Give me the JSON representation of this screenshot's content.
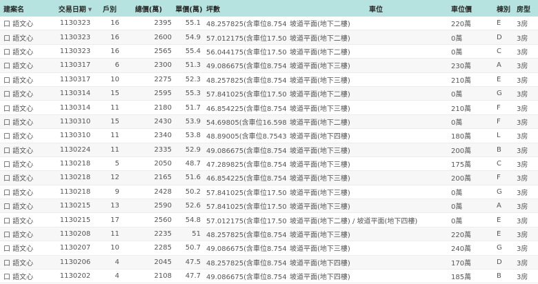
{
  "columns": {
    "name": "建案名",
    "date": "交易日期",
    "households": "戶別",
    "total": "總價(萬)",
    "unit": "單價(萬)",
    "area": "坪數",
    "parking": "車位",
    "parking_price": "車位價",
    "type": "棟別",
    "rooms": "房型"
  },
  "rows": [
    {
      "name": "口 語文心",
      "date": "1130323",
      "households": "16",
      "total": "2395",
      "unit": "55.1",
      "area": "48.257825(含車位8.75435)",
      "parking": "坡道平面(地下二樓)",
      "parking_price": "220萬",
      "type": "E",
      "rooms": "3房"
    },
    {
      "name": "口 語文心",
      "date": "1130323",
      "households": "16",
      "total": "2600",
      "unit": "54.9",
      "area": "57.012175(含車位17.5087)",
      "parking": "坡道平面(地下二樓)",
      "parking_price": "0萬",
      "type": "D",
      "rooms": "3房"
    },
    {
      "name": "口 語文心",
      "date": "1130323",
      "households": "16",
      "total": "2565",
      "unit": "55.4",
      "area": "56.044175(含車位17.5087)",
      "parking": "坡道平面(地下二樓)",
      "parking_price": "0萬",
      "type": "C",
      "rooms": "3房"
    },
    {
      "name": "口 語文心",
      "date": "1130317",
      "households": "6",
      "total": "2300",
      "unit": "51.3",
      "area": "49.086675(含車位8.75435)",
      "parking": "坡道平面(地下三樓)",
      "parking_price": "230萬",
      "type": "A",
      "rooms": "3房"
    },
    {
      "name": "口 語文心",
      "date": "1130317",
      "households": "10",
      "total": "2275",
      "unit": "52.3",
      "area": "48.257825(含車位8.75435)",
      "parking": "坡道平面(地下三樓)",
      "parking_price": "210萬",
      "type": "E",
      "rooms": "3房"
    },
    {
      "name": "口 語文心",
      "date": "1130314",
      "households": "15",
      "total": "2595",
      "unit": "55.3",
      "area": "57.841025(含車位17.5087)",
      "parking": "坡道平面(地下二樓)",
      "parking_price": "0萬",
      "type": "G",
      "rooms": "3房"
    },
    {
      "name": "口 語文心",
      "date": "1130314",
      "households": "11",
      "total": "2180",
      "unit": "51.7",
      "area": "46.854225(含車位8.75435)",
      "parking": "坡道平面(地下三樓)",
      "parking_price": "210萬",
      "type": "F",
      "rooms": "3房"
    },
    {
      "name": "口 語文心",
      "date": "1130310",
      "households": "15",
      "total": "2430",
      "unit": "53.9",
      "area": "54.69805(含車位16.598175)",
      "parking": "坡道平面(地下二樓)",
      "parking_price": "0萬",
      "type": "F",
      "rooms": "3房"
    },
    {
      "name": "口 語文心",
      "date": "1130310",
      "households": "11",
      "total": "2340",
      "unit": "53.8",
      "area": "48.89005(含車位8.75435)",
      "parking": "坡道平面(地下四樓)",
      "parking_price": "180萬",
      "type": "L",
      "rooms": "3房"
    },
    {
      "name": "口 語文心",
      "date": "1130224",
      "households": "11",
      "total": "2335",
      "unit": "52.9",
      "area": "49.086675(含車位8.75435)",
      "parking": "坡道平面(地下三樓)",
      "parking_price": "200萬",
      "type": "B",
      "rooms": "3房"
    },
    {
      "name": "口 語文心",
      "date": "1130218",
      "households": "5",
      "total": "2050",
      "unit": "48.7",
      "area": "47.289825(含車位8.75435)",
      "parking": "坡道平面(地下三樓)",
      "parking_price": "175萬",
      "type": "C",
      "rooms": "3房"
    },
    {
      "name": "口 語文心",
      "date": "1130218",
      "households": "12",
      "total": "2165",
      "unit": "51.6",
      "area": "46.854225(含車位8.75435)",
      "parking": "坡道平面(地下三樓)",
      "parking_price": "200萬",
      "type": "F",
      "rooms": "3房"
    },
    {
      "name": "口 語文心",
      "date": "1130218",
      "households": "9",
      "total": "2428",
      "unit": "50.2",
      "area": "57.841025(含車位17.5087)",
      "parking": "坡道平面(地下三樓)",
      "parking_price": "0萬",
      "type": "G",
      "rooms": "3房"
    },
    {
      "name": "口 語文心",
      "date": "1130215",
      "households": "13",
      "total": "2590",
      "unit": "52.6",
      "area": "57.841025(含車位17.5087)",
      "parking": "坡道平面(地下三樓)",
      "parking_price": "0萬",
      "type": "A",
      "rooms": "3房"
    },
    {
      "name": "口 語文心",
      "date": "1130215",
      "households": "17",
      "total": "2560",
      "unit": "54.8",
      "area": "57.012175(含車位17.5087)",
      "parking": "坡道平面(地下二樓) / 坡道平面(地下四樓)",
      "parking_price": "0萬",
      "type": "E",
      "rooms": "3房"
    },
    {
      "name": "口 語文心",
      "date": "1130208",
      "households": "11",
      "total": "2235",
      "unit": "51",
      "area": "48.257825(含車位8.75435)",
      "parking": "坡道平面(地下三樓)",
      "parking_price": "220萬",
      "type": "E",
      "rooms": "3房"
    },
    {
      "name": "口 語文心",
      "date": "1130207",
      "households": "10",
      "total": "2285",
      "unit": "50.7",
      "area": "49.086675(含車位8.75435)",
      "parking": "坡道平面(地下三樓)",
      "parking_price": "240萬",
      "type": "G",
      "rooms": "3房"
    },
    {
      "name": "口 語文心",
      "date": "1130206",
      "households": "4",
      "total": "2045",
      "unit": "47.5",
      "area": "48.257825(含車位8.75435)",
      "parking": "坡道平面(地下四樓)",
      "parking_price": "170萬",
      "type": "D",
      "rooms": "3房"
    },
    {
      "name": "口 語文心",
      "date": "1130202",
      "households": "4",
      "total": "2108",
      "unit": "47.7",
      "area": "49.086675(含車位8.75435)",
      "parking": "坡道平面(地下四樓)",
      "parking_price": "185萬",
      "type": "B",
      "rooms": "3房"
    }
  ],
  "sort_icon": "sort-descending-icon"
}
